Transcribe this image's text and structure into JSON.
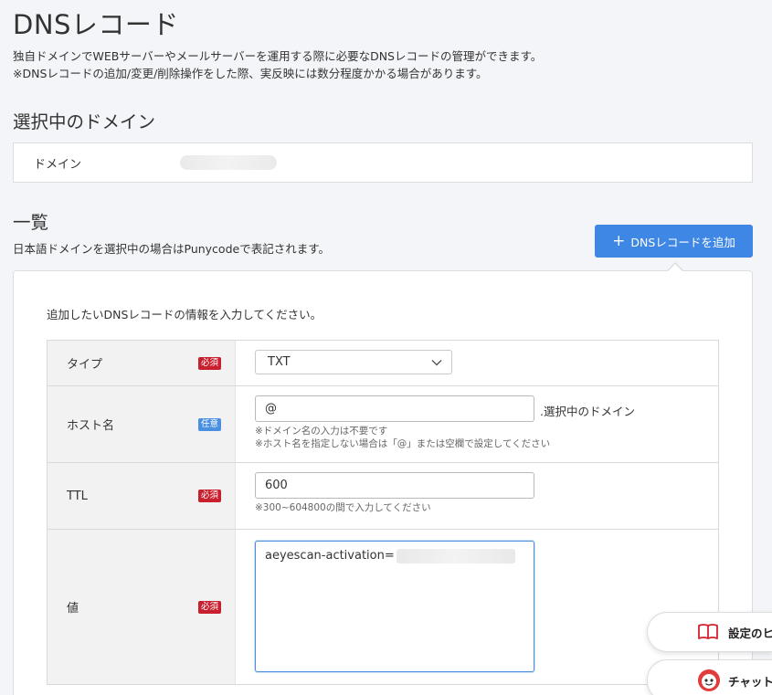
{
  "page": {
    "title": "DNSレコード",
    "description_1": "独自ドメインでWEBサーバーやメールサーバーを運用する際に必要なDNSレコードの管理ができます。",
    "description_2": "※DNSレコードの追加/変更/削除操作をした際、実反映には数分程度かかる場合があります。"
  },
  "selected_domain": {
    "section_title": "選択中のドメイン",
    "label": "ドメイン"
  },
  "list": {
    "section_title": "一覧",
    "note": "日本語ドメインを選択中の場合はPunycodeで表記されます。",
    "add_button": "DNSレコードを追加"
  },
  "form": {
    "intro": "追加したいDNSレコードの情報を入力してください。",
    "rows": [
      {
        "label": "タイプ",
        "badge": "必須",
        "value": "TXT"
      },
      {
        "label": "ホスト名",
        "badge": "任意",
        "value": "@",
        "suffix": ".選択中のドメイン",
        "hints": [
          "※ドメイン名の入力は不要です",
          "※ホスト名を指定しない場合は「@」または空欄で設定してください"
        ]
      },
      {
        "label": "TTL",
        "badge": "必須",
        "value": "600",
        "hints": [
          "※300~604800の間で入力してください"
        ]
      },
      {
        "label": "値",
        "badge": "必須",
        "value": "aeyescan-activation="
      }
    ]
  },
  "floating": {
    "settings_help": "設定のヒ",
    "chatbot": "チャットボッ"
  },
  "colors": {
    "accent": "#3f87e5",
    "required_badge": "#c8202e",
    "optional_badge": "#4a8fe0"
  }
}
